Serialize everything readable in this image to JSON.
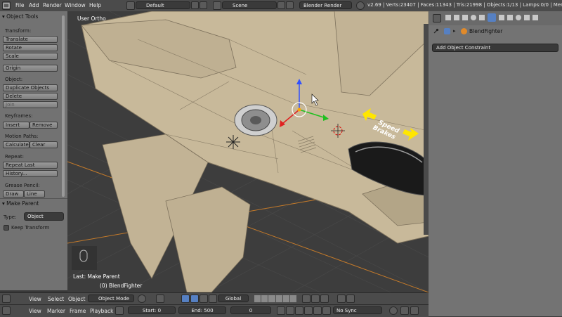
{
  "topbar": {
    "menus": [
      "File",
      "Add",
      "Render",
      "Window",
      "Help"
    ],
    "screen_layout": "Default",
    "scene": "Scene",
    "render_engine": "Blender Render",
    "stats": "v2.69 | Verts:23407 | Faces:11343 | Tris:21998 | Objects:1/13 | Lamps:0/0 | Mem:29..."
  },
  "tools": {
    "header": "Object Tools",
    "transform_label": "Transform:",
    "translate": "Translate",
    "rotate": "Rotate",
    "scale": "Scale",
    "origin": "Origin",
    "object_label": "Object:",
    "duplicate": "Duplicate Objects",
    "delete": "Delete",
    "join": "Join",
    "keyframes_label": "Keyframes:",
    "insert": "Insert",
    "remove": "Remove",
    "motion_label": "Motion Paths:",
    "calculate": "Calculate",
    "clear": "Clear",
    "repeat_label": "Repeat:",
    "repeat_last": "Repeat Last",
    "history": "History...",
    "grease_label": "Grease Pencil:",
    "draw": "Draw",
    "line": "Line"
  },
  "make_parent": {
    "header": "Make Parent",
    "type_label": "Type:",
    "type_value": "Object",
    "keep_transform": "Keep Transform"
  },
  "viewport": {
    "view_label": "User Ortho",
    "last_op": "Last: Make Parent",
    "object_name": "(0) BlendFighter",
    "annotation_line1": "Speed",
    "annotation_line2": "Brakes"
  },
  "properties": {
    "object_name": "BlendFighter",
    "add_constraint": "Add Object Constraint"
  },
  "header3d": {
    "menus": [
      "View",
      "Select",
      "Object"
    ],
    "mode": "Object Mode",
    "orientation": "Global"
  },
  "timeline": {
    "menus": [
      "View",
      "Marker",
      "Frame",
      "Playback"
    ],
    "start": "Start: 0",
    "end": "End: 500",
    "current": "0",
    "sync": "No Sync"
  },
  "colors": {
    "accent": "#5680c2",
    "body": "#c8b99a",
    "panel": "#727272",
    "arrow": "#ffe600"
  }
}
